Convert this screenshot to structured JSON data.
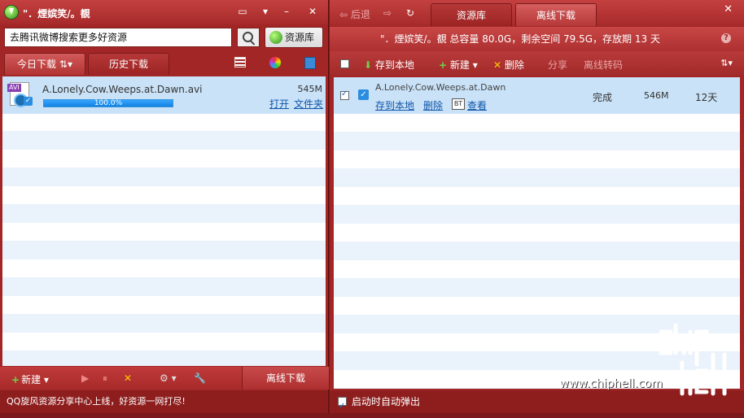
{
  "left": {
    "title": "\"．煙嫔笑/。覩",
    "search": {
      "value": "去腾讯微博搜索更多好资源"
    },
    "resource_lib_label": "资源库",
    "tabs": [
      {
        "label": "今日下载"
      },
      {
        "label": "历史下载"
      }
    ],
    "sort_glyph": "⇅",
    "download": {
      "filename": "A.Lonely.Cow.Weeps.at.Dawn.avi",
      "type_tag": "AVI",
      "size": "545M",
      "progress_text": "100.0%",
      "progress_fraction": 1.0,
      "open_label": "打开",
      "folder_label": "文件夹"
    },
    "bottom": {
      "new_label": "新建",
      "offline_label": "离线下载"
    },
    "status_text": "QQ旋风资源分享中心上线，好资源一网打尽!"
  },
  "right": {
    "nav": {
      "back_label": "后退"
    },
    "tabs": [
      {
        "label": "资源库"
      },
      {
        "label": "离线下载"
      }
    ],
    "info_text": "\"．煙嫔笑/。覩   总容量 80.0G，剩余空间 79.5G，存放期 13 天",
    "toolbar": {
      "save_label": "存到本地",
      "new_label": "新建",
      "delete_label": "删除",
      "share_label": "分享",
      "transcode_label": "离线转码"
    },
    "task": {
      "name": "A.Lonely.Cow.Weeps.at.Dawn",
      "save_label": "存到本地",
      "delete_label": "删除",
      "bt_badge": "BT",
      "view_label": "查看",
      "status": "完成",
      "size": "546M",
      "days": "12天"
    },
    "status_checkbox_label": "启动时自动弹出"
  },
  "watermark": {
    "text": "www.chiphell.com"
  }
}
